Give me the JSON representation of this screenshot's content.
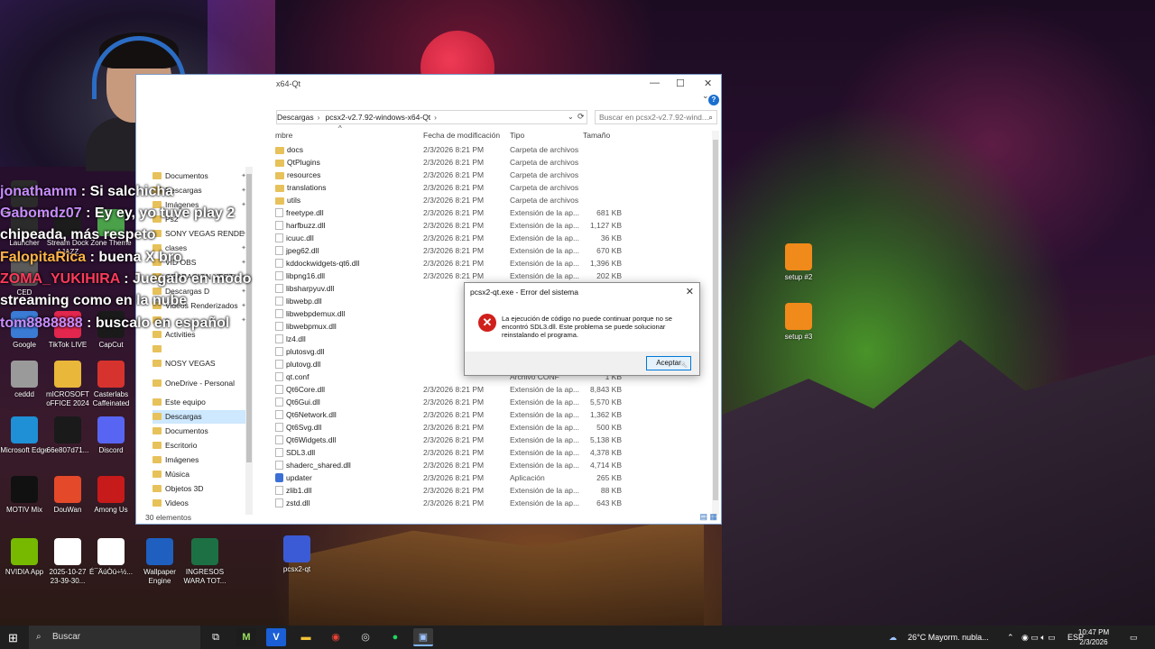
{
  "explorer": {
    "window_title": "x64-Qt",
    "breadcrumb": [
      "Descargas",
      "pcsx2-v2.7.92-windows-x64-Qt"
    ],
    "search_placeholder": "Buscar en pcsx2-v2.7.92-wind...",
    "columns": {
      "name": "mbre",
      "date": "Fecha de modificación",
      "type": "Tipo",
      "size": "Tamaño"
    },
    "nav_items": [
      {
        "label": "Documentos",
        "pinned": true
      },
      {
        "label": "Descargas",
        "pinned": true
      },
      {
        "label": "Imágenes",
        "pinned": true
      },
      {
        "label": "Ps2",
        "pinned": false
      },
      {
        "label": "SONY VEGAS RENDE",
        "pinned": true
      },
      {
        "label": "clases",
        "pinned": true
      },
      {
        "label": "VID OBS",
        "pinned": true
      },
      {
        "label": "GRABACION VERTI",
        "pinned": true
      },
      {
        "label": "Descargas D",
        "pinned": true
      },
      {
        "label": "Videos Renderizados",
        "pinned": true
      },
      {
        "label": "a",
        "pinned": true
      },
      {
        "label": "Activities",
        "pinned": false
      },
      {
        "label": "",
        "pinned": false
      },
      {
        "label": "NOSY VEGAS",
        "pinned": false
      },
      {
        "label": "OneDrive - Personal",
        "pinned": false
      },
      {
        "label": "Este equipo",
        "pinned": false
      },
      {
        "label": "Descargas",
        "pinned": false,
        "selected": true
      },
      {
        "label": "Documentos",
        "pinned": false
      },
      {
        "label": "Escritorio",
        "pinned": false
      },
      {
        "label": "Imágenes",
        "pinned": false
      },
      {
        "label": "Música",
        "pinned": false
      },
      {
        "label": "Objetos 3D",
        "pinned": false
      },
      {
        "label": "Videos",
        "pinned": false
      }
    ],
    "files": [
      {
        "name": "docs",
        "date": "2/3/2026 8:21 PM",
        "type": "Carpeta de archivos",
        "size": "",
        "kind": "folder"
      },
      {
        "name": "QtPlugins",
        "date": "2/3/2026 8:21 PM",
        "type": "Carpeta de archivos",
        "size": "",
        "kind": "folder"
      },
      {
        "name": "resources",
        "date": "2/3/2026 8:21 PM",
        "type": "Carpeta de archivos",
        "size": "",
        "kind": "folder"
      },
      {
        "name": "translations",
        "date": "2/3/2026 8:21 PM",
        "type": "Carpeta de archivos",
        "size": "",
        "kind": "folder"
      },
      {
        "name": "utils",
        "date": "2/3/2026 8:21 PM",
        "type": "Carpeta de archivos",
        "size": "",
        "kind": "folder"
      },
      {
        "name": "freetype.dll",
        "date": "2/3/2026 8:21 PM",
        "type": "Extensión de la ap...",
        "size": "681 KB",
        "kind": "file"
      },
      {
        "name": "harfbuzz.dll",
        "date": "2/3/2026 8:21 PM",
        "type": "Extensión de la ap...",
        "size": "1,127 KB",
        "kind": "file"
      },
      {
        "name": "icuuc.dll",
        "date": "2/3/2026 8:21 PM",
        "type": "Extensión de la ap...",
        "size": "36 KB",
        "kind": "file"
      },
      {
        "name": "jpeg62.dll",
        "date": "2/3/2026 8:21 PM",
        "type": "Extensión de la ap...",
        "size": "670 KB",
        "kind": "file"
      },
      {
        "name": "kddockwidgets-qt6.dll",
        "date": "2/3/2026 8:21 PM",
        "type": "Extensión de la ap...",
        "size": "1,396 KB",
        "kind": "file"
      },
      {
        "name": "libpng16.dll",
        "date": "2/3/2026 8:21 PM",
        "type": "Extensión de la ap...",
        "size": "202 KB",
        "kind": "file"
      },
      {
        "name": "libsharpyuv.dll",
        "date": "",
        "type": "",
        "size": "",
        "kind": "file"
      },
      {
        "name": "libwebp.dll",
        "date": "",
        "type": "",
        "size": "",
        "kind": "file"
      },
      {
        "name": "libwebpdemux.dll",
        "date": "",
        "type": "",
        "size": "",
        "kind": "file"
      },
      {
        "name": "libwebpmux.dll",
        "date": "",
        "type": "",
        "size": "",
        "kind": "file"
      },
      {
        "name": "lz4.dll",
        "date": "",
        "type": "",
        "size": "",
        "kind": "file"
      },
      {
        "name": "plutosvg.dll",
        "date": "",
        "type": "",
        "size": "",
        "kind": "file"
      },
      {
        "name": "plutovg.dll",
        "date": "",
        "type": "",
        "size": "",
        "kind": "file"
      },
      {
        "name": "qt.conf",
        "date": "",
        "type": "Archivo CONF",
        "size": "1 KB",
        "kind": "file"
      },
      {
        "name": "Qt6Core.dll",
        "date": "2/3/2026 8:21 PM",
        "type": "Extensión de la ap...",
        "size": "8,843 KB",
        "kind": "file"
      },
      {
        "name": "Qt6Gui.dll",
        "date": "2/3/2026 8:21 PM",
        "type": "Extensión de la ap...",
        "size": "5,570 KB",
        "kind": "file"
      },
      {
        "name": "Qt6Network.dll",
        "date": "2/3/2026 8:21 PM",
        "type": "Extensión de la ap...",
        "size": "1,362 KB",
        "kind": "file"
      },
      {
        "name": "Qt6Svg.dll",
        "date": "2/3/2026 8:21 PM",
        "type": "Extensión de la ap...",
        "size": "500 KB",
        "kind": "file"
      },
      {
        "name": "Qt6Widgets.dll",
        "date": "2/3/2026 8:21 PM",
        "type": "Extensión de la ap...",
        "size": "5,138 KB",
        "kind": "file"
      },
      {
        "name": "SDL3.dll",
        "date": "2/3/2026 8:21 PM",
        "type": "Extensión de la ap...",
        "size": "4,378 KB",
        "kind": "file"
      },
      {
        "name": "shaderc_shared.dll",
        "date": "2/3/2026 8:21 PM",
        "type": "Extensión de la ap...",
        "size": "4,714 KB",
        "kind": "file"
      },
      {
        "name": "updater",
        "date": "2/3/2026 8:21 PM",
        "type": "Aplicación",
        "size": "265 KB",
        "kind": "app"
      },
      {
        "name": "zlib1.dll",
        "date": "2/3/2026 8:21 PM",
        "type": "Extensión de la ap...",
        "size": "88 KB",
        "kind": "file"
      },
      {
        "name": "zstd.dll",
        "date": "2/3/2026 8:21 PM",
        "type": "Extensión de la ap...",
        "size": "643 KB",
        "kind": "file"
      }
    ],
    "status": "30 elementos"
  },
  "dialog": {
    "title": "pcsx2-qt.exe - Error del sistema",
    "message": "La ejecución de código no puede continuar porque no se encontró SDL3.dll. Este problema se puede solucionar reinstalando el programa.",
    "ok_label": "Aceptar"
  },
  "chat": [
    {
      "user": "jonathamm",
      "msg": " : Si salchicha",
      "user_color": "#c98cff"
    },
    {
      "user": "Gabomdz07",
      "msg": " : Ey ey, yo tuve play 2 chipeada, más respeto",
      "user_color": "#c98cff"
    },
    {
      "user": "FalopitaRica",
      "msg": " : buena X bro",
      "user_color": "#ffb347"
    },
    {
      "user": "ZOMA_YUKIHIRA",
      "msg": " : Juegalo en modo streaming como en la nube",
      "user_color": "#ff3a5c"
    },
    {
      "user": "tom8888888",
      "msg": " : buscalo en español",
      "user_color": "#c98cff"
    }
  ],
  "desktop_icons": [
    {
      "label": "EPIC GAMES",
      "color": "#2b2b2b"
    },
    {
      "label": "Launcher",
      "color": "#2b2b2b"
    },
    {
      "label": "Stream Dock AJAZZ",
      "color": "#1c1c1c"
    },
    {
      "label": "Zone Theme",
      "color": "#4aa14a"
    },
    {
      "label": "CED",
      "color": "#5a5a5a"
    },
    {
      "label": "Google",
      "color": "#3a7bd5"
    },
    {
      "label": "TikTok LIVE",
      "color": "#e2264d"
    },
    {
      "label": "CapCut",
      "color": "#1a1a1a"
    },
    {
      "label": "ceddd",
      "color": "#9a9a9a"
    },
    {
      "label": "mICROSOFT oFFICE 2024",
      "color": "#e9b73a"
    },
    {
      "label": "Casterlabs Caffeinated",
      "color": "#d6332e"
    },
    {
      "label": "Microsoft Edge",
      "color": "#1f8fd6"
    },
    {
      "label": "66e807d71...",
      "color": "#1a1a1a"
    },
    {
      "label": "Discord",
      "color": "#5865f2"
    },
    {
      "label": "MOTIV Mix",
      "color": "#111111"
    },
    {
      "label": "DouWan",
      "color": "#e4492a"
    },
    {
      "label": "Among Us",
      "color": "#c71a1a"
    },
    {
      "label": "NVIDIA App",
      "color": "#76b900"
    },
    {
      "label": "2025-10-27 23-39-30...",
      "color": "#ffffff"
    },
    {
      "label": "É¯ÄúÒü÷½...",
      "color": "#ffffff"
    },
    {
      "label": "Wallpaper Engine",
      "color": "#1e5fbf"
    },
    {
      "label": "INGRESOS WARA TOT...",
      "color": "#1d7044"
    },
    {
      "label": "pcsx2-qt",
      "color": "#3b5bd6"
    },
    {
      "label": "setup #2",
      "color": "#f08a1a"
    },
    {
      "label": "setup #3",
      "color": "#f08a1a"
    }
  ],
  "taskbar": {
    "search_placeholder": "Buscar",
    "weather": "26°C  Mayorm. nubla...",
    "lang": "ESP",
    "time": "10:47 PM",
    "date": "2/3/2026"
  }
}
